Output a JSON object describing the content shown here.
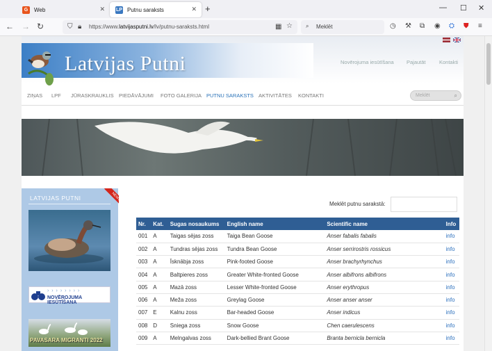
{
  "browser": {
    "tabs": [
      {
        "label": "Web",
        "favicon": "G",
        "favicon_color": "#e8541c"
      },
      {
        "label": "Putnu saraksts",
        "favicon": "LP",
        "favicon_color": "#3a78c0"
      }
    ],
    "url_prefix": "https://www.",
    "url_domain": "latvijasputni.lv",
    "url_path": "/lv/putnu-saraksts.html",
    "search_placeholder": "Meklēt"
  },
  "site": {
    "logo_text": "Latvijas Putni",
    "top_links": [
      "Novērojuma iesūtīšana",
      "Pajautāt",
      "Kontakti"
    ],
    "nav": [
      "ZIŅAS",
      "LPF",
      "JŪRASKRAUKLIS",
      "PIEDĀVĀJUMI",
      "FOTO GALERIJA",
      "PUTNU SARAKSTS",
      "AKTIVITĀTES",
      "KONTAKTI"
    ],
    "active_nav": "PUTNU SARAKSTS",
    "search_placeholder": "Meklēt",
    "accent_color": "#2f5e94"
  },
  "sidebar": {
    "title": "LATVIJAS PUTNI",
    "ribbon": "NEWS",
    "banner1": "NOVĒROJUMA IESŪTĪŠANA",
    "banner2": "PAVASARA MIGRANTI 2022"
  },
  "list": {
    "search_label": "Meklēt putnu sarakstā:",
    "columns": [
      "Nr.",
      "Kat.",
      "Sugas nosaukums",
      "English name",
      "Scientific name",
      "Info"
    ],
    "rows": [
      [
        "001",
        "A",
        "Taigas sējas zoss",
        "Taiga Bean Goose",
        "Anser fabalis fabalis",
        "info"
      ],
      [
        "002",
        "A",
        "Tundras sējas zoss",
        "Tundra Bean Goose",
        "Anser serrirostris rossicus",
        "info"
      ],
      [
        "003",
        "A",
        "Īsknābja zoss",
        "Pink-footed Goose",
        "Anser brachyrhynchus",
        "info"
      ],
      [
        "004",
        "A",
        "Baltpieres zoss",
        "Greater White-fronted Goose",
        "Anser albifrons albifrons",
        "info"
      ],
      [
        "005",
        "A",
        "Mazā zoss",
        "Lesser White-fronted Goose",
        "Anser erythropus",
        "info"
      ],
      [
        "006",
        "A",
        "Meža zoss",
        "Greylag Goose",
        "Anser anser anser",
        "info"
      ],
      [
        "007",
        "E",
        "Kalnu zoss",
        "Bar-headed Goose",
        "Anser indicus",
        "info"
      ],
      [
        "008",
        "D",
        "Sniega zoss",
        "Snow Goose",
        "Chen caerulescens",
        "info"
      ],
      [
        "009",
        "A",
        "Melngalvas zoss",
        "Dark-bellied Brant Goose",
        "Branta bernicla bernicla",
        "info"
      ]
    ]
  }
}
